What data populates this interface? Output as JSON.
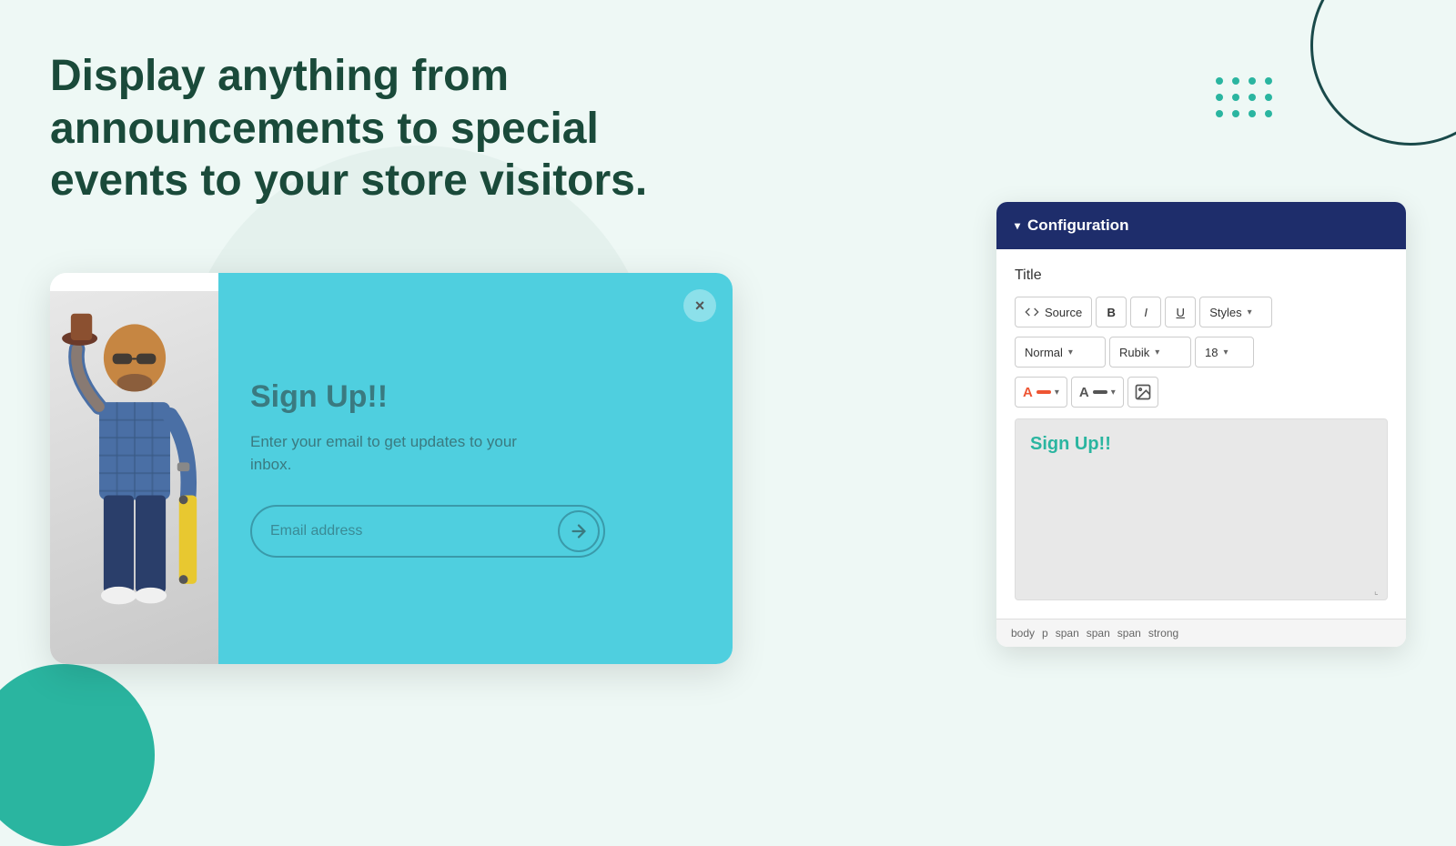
{
  "page": {
    "background_color": "#eef8f5"
  },
  "hero": {
    "title": "Display anything from announcements to special events to your store visitors."
  },
  "popup": {
    "title": "Sign Up!!",
    "subtitle": "Enter your email to get updates to your inbox.",
    "email_placeholder": "Email address",
    "close_label": "×"
  },
  "config": {
    "header_label": "Configuration",
    "chevron": "▾",
    "section_title": "Title",
    "toolbar": {
      "source_label": "Source",
      "bold_label": "B",
      "italic_label": "I",
      "underline_label": "U",
      "styles_label": "Styles",
      "dropdown_arrow": "▾"
    },
    "toolbar2": {
      "format_label": "Normal",
      "format_arrow": "▾",
      "font_label": "Rubik",
      "font_arrow": "▾",
      "size_label": "18",
      "size_arrow": "▾"
    },
    "toolbar3": {
      "text_color_label": "A",
      "bg_color_label": "A",
      "image_label": "🖼"
    },
    "editor_content": "Sign Up!!",
    "status_bar": {
      "items": [
        "body",
        "p",
        "span",
        "span",
        "span",
        "strong"
      ]
    }
  },
  "decorative": {
    "dot_count": 12
  }
}
